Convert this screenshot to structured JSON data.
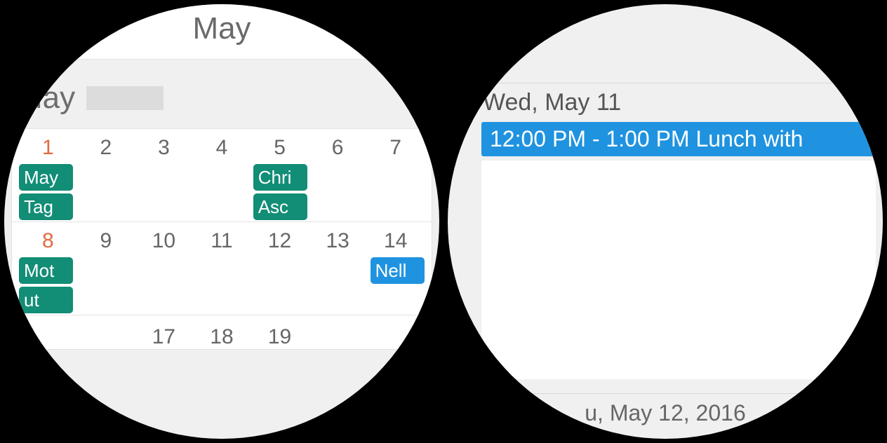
{
  "left": {
    "title": "May",
    "subtitle": "May",
    "weeks": [
      {
        "days": [
          "1",
          "2",
          "3",
          "4",
          "5",
          "6",
          "7"
        ],
        "red_index": 0,
        "events": [
          [
            "May",
            "",
            "",
            "",
            "Chri",
            "",
            ""
          ],
          [
            "Tag",
            "",
            "",
            "",
            "Asc",
            "",
            ""
          ]
        ]
      },
      {
        "days": [
          "8",
          "9",
          "10",
          "11",
          "12",
          "13",
          "14"
        ],
        "red_index": 0,
        "events": [
          [
            "Mot",
            "",
            "",
            "",
            "",
            "",
            "Nell"
          ],
          [
            "ut",
            "",
            "",
            "",
            "",
            "",
            ""
          ]
        ]
      },
      {
        "days": [
          "",
          "",
          "17",
          "18",
          "19",
          "",
          ""
        ],
        "red_index": -1,
        "events": []
      }
    ],
    "chip_colors": {
      "Nell": "blue"
    }
  },
  "right": {
    "date_header": "Wed, May 11",
    "event_text": "12:00 PM - 1:00 PM Lunch with",
    "next_date": "u, May 12, 2016"
  }
}
